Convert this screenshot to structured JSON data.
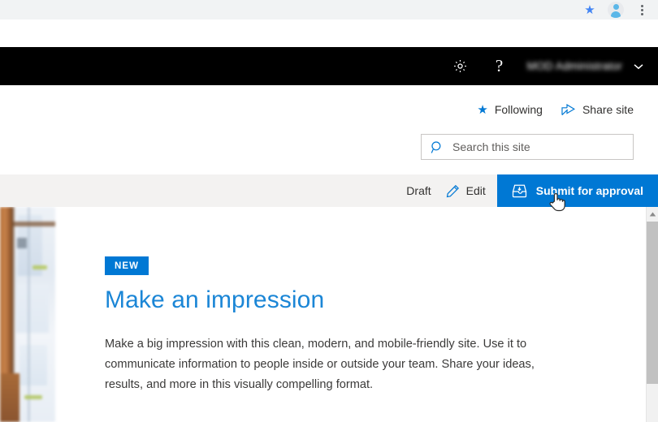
{
  "browser": {
    "bookmark_icon": "star-icon",
    "profile_icon": "avatar-icon",
    "menu_icon": "kebab-menu-icon"
  },
  "suite_bar": {
    "settings_icon": "gear-icon",
    "help_icon": "question-mark-icon",
    "user_name": "MOD Administrator",
    "caret_icon": "chevron-down-icon",
    "background": "#000000"
  },
  "site_header": {
    "following_label": "Following",
    "following_icon": "star-icon",
    "share_label": "Share site",
    "share_icon": "share-icon",
    "search": {
      "placeholder": "Search this site",
      "value": "",
      "icon": "search-icon"
    }
  },
  "command_bar": {
    "status_label": "Draft",
    "edit_label": "Edit",
    "edit_icon": "pencil-icon",
    "submit_label": "Submit for approval",
    "submit_icon": "inbox-tray-icon",
    "submit_color": "#0078d4",
    "background": "#f3f2f1"
  },
  "page": {
    "hero_image": "blueprint-window-photo",
    "badge": "NEW",
    "badge_color": "#0078d4",
    "title": "Make an impression",
    "title_color": "#1b86d6",
    "paragraph": "Make a big impression with this clean, modern, and mobile-friendly site. Use it to communicate information to people inside or outside your team. Share your ideas, results, and more in this visually compelling format."
  },
  "scrollbar": {
    "up_arrow_icon": "caret-up-icon",
    "position": "top"
  },
  "cursor": {
    "type": "pointer-hand-cursor"
  }
}
